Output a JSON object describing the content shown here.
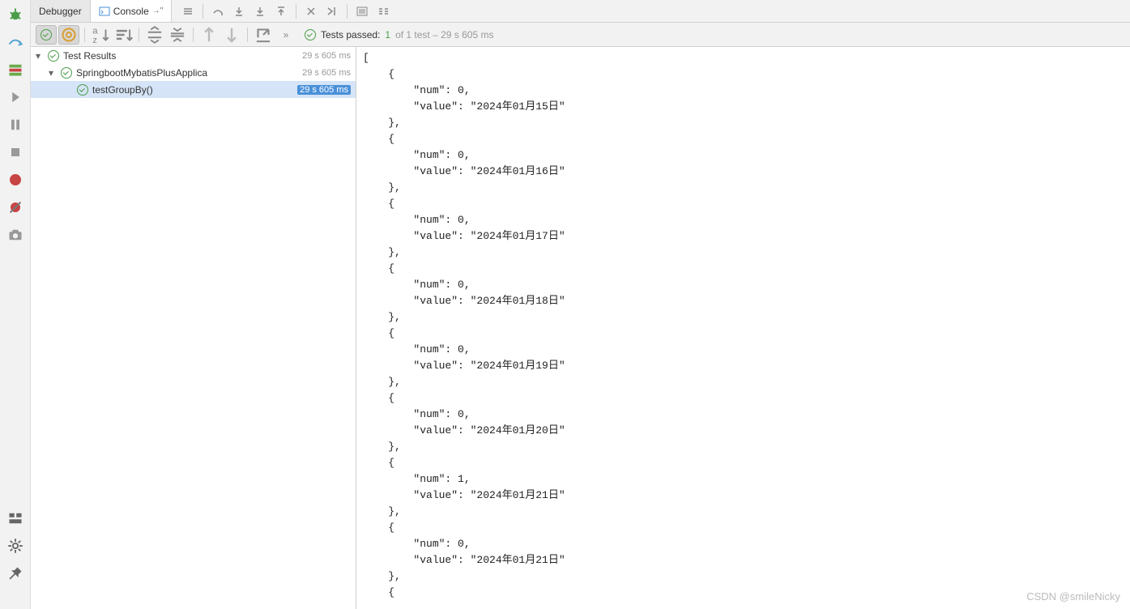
{
  "tabs": {
    "debugger": "Debugger",
    "console": "Console"
  },
  "test_status": {
    "prefix": "Tests passed:",
    "count": "1",
    "of": "of 1 test – 29 s 605 ms"
  },
  "tree": {
    "root": {
      "label": "Test Results",
      "time": "29 s 605 ms"
    },
    "class": {
      "label": "SpringbootMybatisPlusApplica",
      "time": "29 s 605 ms"
    },
    "method": {
      "label": "testGroupBy()",
      "time": "29 s 605 ms"
    }
  },
  "console_output": [
    {
      "num": 0,
      "value": "2024年01月15日"
    },
    {
      "num": 0,
      "value": "2024年01月16日"
    },
    {
      "num": 0,
      "value": "2024年01月17日"
    },
    {
      "num": 0,
      "value": "2024年01月18日"
    },
    {
      "num": 0,
      "value": "2024年01月19日"
    },
    {
      "num": 0,
      "value": "2024年01月20日"
    },
    {
      "num": 1,
      "value": "2024年01月21日"
    },
    {
      "num": 0,
      "value": "2024年01月21日"
    }
  ],
  "watermark": "CSDN @smileNicky"
}
